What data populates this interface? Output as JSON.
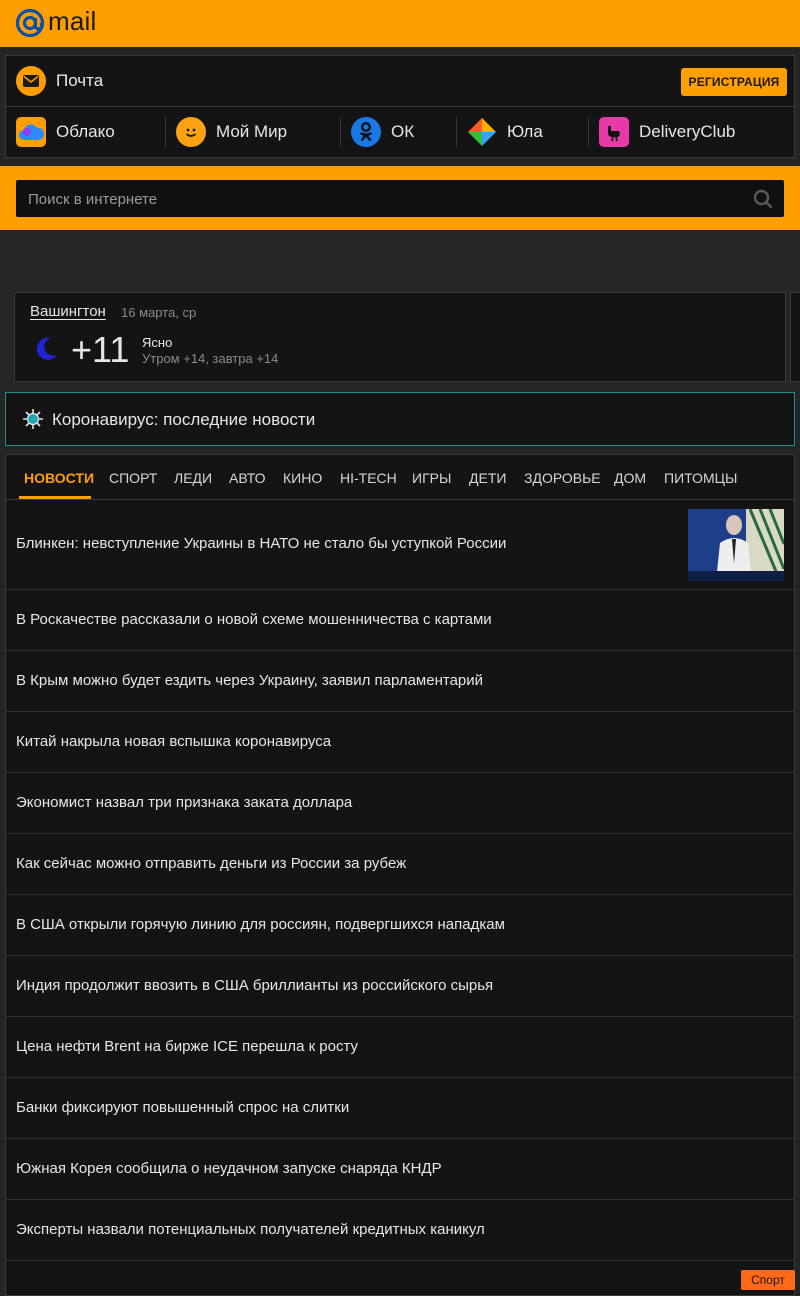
{
  "header": {
    "logo_text": "mail",
    "brand_color": "#ff9e00"
  },
  "projects": {
    "mail_label": "Почта",
    "register_label": "РЕГИСТРАЦИЯ",
    "items": [
      {
        "label": "Облако",
        "icon": "cloud-icon"
      },
      {
        "label": "Мой Мир",
        "icon": "smile-icon"
      },
      {
        "label": "ОК",
        "icon": "odnoklassniki-icon"
      },
      {
        "label": "Юла",
        "icon": "youla-icon"
      },
      {
        "label": "DeliveryClub",
        "icon": "ostrich-icon"
      }
    ]
  },
  "search": {
    "placeholder": "Поиск в интернете"
  },
  "weather": {
    "city": "Вашингтон",
    "date": "16 марта, ср",
    "temp": "+11",
    "condition": "Ясно",
    "forecast": "Утром +14, завтра +14",
    "icon": "moon-icon"
  },
  "corona": {
    "label": "Коронавирус: последние новости",
    "icon": "virus-icon"
  },
  "news": {
    "tabs": [
      "НОВОСТИ",
      "СПОРТ",
      "ЛЕДИ",
      "АВТО",
      "КИНО",
      "HI-TECH",
      "ИГРЫ",
      "ДЕТИ",
      "ЗДОРОВЬЕ",
      "ДОМ",
      "ПИТОМЦЫ"
    ],
    "active_tab": "НОВОСТИ",
    "items": [
      "Блинкен: невступление Украины в НАТО не стало бы уступкой России",
      "В Роскачестве рассказали о новой схеме мошенничества с картами",
      "В Крым можно будет ездить через Украину, заявил парламентарий",
      "Китай накрыла новая вспышка коронавируса",
      "Экономист назвал три признака заката доллара",
      "Как сейчас можно отправить деньги из России за рубеж",
      "В США открыли горячую линию для россиян, подвергшихся нападкам",
      "Индия продолжит ввозить в США бриллианты из российского сырья",
      "Цена нефти Brent на бирже ICE перешла к росту",
      "Банки фиксируют повышенный спрос на слитки",
      "Южная Корея сообщила о неудачном запуске снаряда КНДР",
      "Эксперты назвали потенциальных получателей кредитных каникул"
    ],
    "badge": "Спорт"
  }
}
